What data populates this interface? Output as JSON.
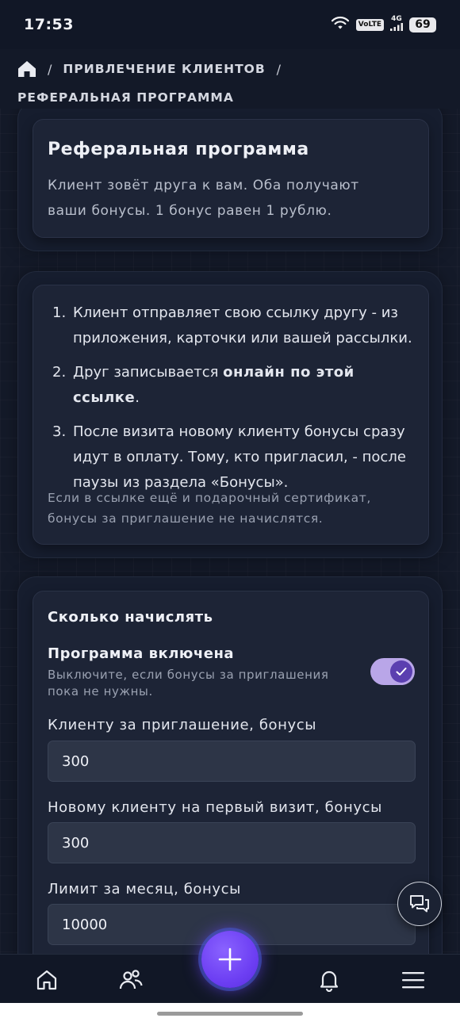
{
  "status_bar": {
    "time": "17:53",
    "volte": "VoLTE",
    "network": "4G",
    "battery": "69"
  },
  "breadcrumb": {
    "home_icon": "home-icon",
    "separator": "/",
    "level1": "ПРИВЛЕЧЕНИЕ КЛИЕНТОВ",
    "current": "РЕФЕРАЛЬНАЯ ПРОГРАММА"
  },
  "intro": {
    "title": "Реферальная программа",
    "description_line1": "Клиент зовёт друга к вам. Оба получают",
    "description_line2": "ваши бонусы. 1 бонус равен 1 рублю."
  },
  "steps": [
    {
      "num": "1.",
      "line1": "Клиент отправляет свою ссылку другу - из",
      "line2": "приложения, карточки или вашей рассылки."
    },
    {
      "num": "2.",
      "before": "Друг записывается ",
      "bold": "онлайн по этой ссылке",
      "after": "."
    },
    {
      "num": "3.",
      "line1": "После визита новому клиенту бонусы сразу",
      "line2": "идут в оплату. Тому, кто пригласил, - после",
      "line3": "паузы из раздела «Бонусы»."
    }
  ],
  "steps_note": {
    "line1": "Если в ссылке ещё и подарочный сертификат,",
    "line2": "бонусы за приглашение не начислятся."
  },
  "settings": {
    "title": "Сколько начислять",
    "toggle": {
      "label": "Программа включена",
      "hint_line1": "Выключите, если бонусы за приглашения",
      "hint_line2": "пока не нужны.",
      "enabled": true
    },
    "fields": [
      {
        "label": "Клиенту за приглашение, бонусы",
        "value": "300"
      },
      {
        "label": "Новому клиенту на первый визит, бонусы",
        "value": "300"
      },
      {
        "label": "Лимит за месяц, бонусы",
        "value": "10000"
      }
    ]
  },
  "bottom_nav": {
    "items": [
      "home-icon",
      "users-icon",
      "plus-icon",
      "bell-icon",
      "menu-icon"
    ]
  },
  "colors": {
    "background": "#141a29",
    "card": "#1d2436",
    "accent": "#6d3ff3",
    "toggle_track": "#b9a6e8"
  }
}
